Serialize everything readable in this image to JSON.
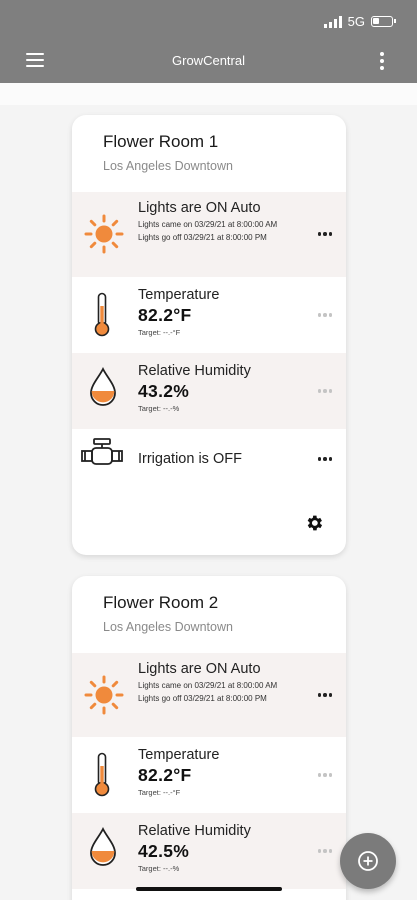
{
  "status_bar": {
    "network": "5G"
  },
  "app": {
    "title": "GrowCentral"
  },
  "rooms": [
    {
      "name": "Flower Room 1",
      "location": "Los Angeles Downtown",
      "lights": {
        "title": "Lights are ON Auto",
        "came_on": "Lights came on 03/29/21 at 8:00:00 AM",
        "go_off": "Lights go off 03/29/21 at 8:00:00 PM"
      },
      "temperature": {
        "title": "Temperature",
        "value": "82.2°F",
        "target": "Target: --.-°F"
      },
      "humidity": {
        "title": "Relative Humidity",
        "value": "43.2%",
        "target": "Target: --.-%"
      },
      "irrigation": {
        "title": "Irrigation is OFF"
      }
    },
    {
      "name": "Flower Room 2",
      "location": "Los Angeles Downtown",
      "lights": {
        "title": "Lights are ON Auto",
        "came_on": "Lights came on 03/29/21 at 8:00:00 AM",
        "go_off": "Lights go off 03/29/21 at 8:00:00 PM"
      },
      "temperature": {
        "title": "Temperature",
        "value": "82.2°F",
        "target": "Target: --.-°F"
      },
      "humidity": {
        "title": "Relative Humidity",
        "value": "42.5%",
        "target": "Target: --.-%"
      }
    }
  ],
  "colors": {
    "accent": "#f08a3c",
    "appbar": "#7f7f7f",
    "row_tint": "#f6f2f1"
  },
  "icons": [
    "menu-icon",
    "more-vert-icon",
    "sun-icon",
    "thermometer-icon",
    "water-drop-icon",
    "valve-icon",
    "gear-icon",
    "add-circle-icon"
  ]
}
